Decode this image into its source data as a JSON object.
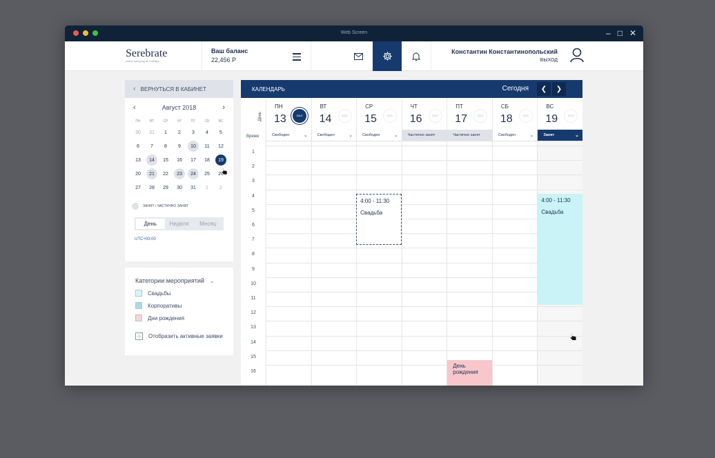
{
  "window": {
    "title": "Web Screen"
  },
  "header": {
    "logo_name": "Serebrate",
    "logo_tagline": "online shopping all holidays",
    "balance_label": "Ваш баланс",
    "balance_value": "22,456 Р",
    "user_name": "Константин Константинопольский",
    "logout_label": "ВЫХОД"
  },
  "sidebar": {
    "back_label": "ВЕРНУТЬСЯ В КАБИНЕТ",
    "mini_calendar": {
      "month_label": "Август 2018",
      "weekdays": [
        "ПН",
        "ВТ",
        "СР",
        "ЧТ",
        "ПТ",
        "СБ",
        "ВС"
      ],
      "days": [
        {
          "d": "30",
          "s": "muted"
        },
        {
          "d": "31",
          "s": "muted"
        },
        {
          "d": "1",
          "s": ""
        },
        {
          "d": "2",
          "s": ""
        },
        {
          "d": "3",
          "s": ""
        },
        {
          "d": "4",
          "s": ""
        },
        {
          "d": "5",
          "s": ""
        },
        {
          "d": "6",
          "s": ""
        },
        {
          "d": "7",
          "s": ""
        },
        {
          "d": "8",
          "s": ""
        },
        {
          "d": "9",
          "s": ""
        },
        {
          "d": "10",
          "s": "busy"
        },
        {
          "d": "11",
          "s": ""
        },
        {
          "d": "12",
          "s": ""
        },
        {
          "d": "13",
          "s": ""
        },
        {
          "d": "14",
          "s": "busy"
        },
        {
          "d": "15",
          "s": ""
        },
        {
          "d": "16",
          "s": ""
        },
        {
          "d": "17",
          "s": ""
        },
        {
          "d": "18",
          "s": ""
        },
        {
          "d": "19",
          "s": "sel"
        },
        {
          "d": "20",
          "s": ""
        },
        {
          "d": "21",
          "s": "busy"
        },
        {
          "d": "22",
          "s": ""
        },
        {
          "d": "23",
          "s": "busy"
        },
        {
          "d": "24",
          "s": "busy"
        },
        {
          "d": "25",
          "s": ""
        },
        {
          "d": "26",
          "s": ""
        },
        {
          "d": "27",
          "s": ""
        },
        {
          "d": "28",
          "s": ""
        },
        {
          "d": "29",
          "s": ""
        },
        {
          "d": "30",
          "s": ""
        },
        {
          "d": "31",
          "s": ""
        },
        {
          "d": "1",
          "s": "muted"
        },
        {
          "d": "2",
          "s": "muted"
        }
      ],
      "legend_busy": "ЗАНЯТ / ЧАСТИЧНО ЗАНЯТ"
    },
    "view_switch": [
      "День",
      "Неделя",
      "Месяц"
    ],
    "view_active": "День",
    "timezone": "UTC+03:00",
    "categories": {
      "title": "Категории мероприятий",
      "items": [
        {
          "label": "Свадьбы",
          "color": "#d6f6f8"
        },
        {
          "label": "Корпоративы",
          "color": "#a9dbea"
        },
        {
          "label": "Дни рождения",
          "color": "#f9d4d8"
        }
      ],
      "show_active_label": "Отобразить активные заявки"
    }
  },
  "calendar": {
    "bar_title": "КАЛЕНДАРЬ",
    "today_label": "Сегодня",
    "day_vertical_label": "День",
    "time_label": "Время",
    "sale_label": "SALE",
    "days": [
      {
        "dow": "ПН",
        "num": "13",
        "status": "Свободен",
        "status_type": "free",
        "sale_dark": true
      },
      {
        "dow": "ВТ",
        "num": "14",
        "status": "Свободен",
        "status_type": "free",
        "sale_dark": false
      },
      {
        "dow": "СР",
        "num": "15",
        "status": "Свободен",
        "status_type": "free",
        "sale_dark": false
      },
      {
        "dow": "ЧТ",
        "num": "16",
        "status": "Частично занят",
        "status_type": "partial",
        "sale_dark": false
      },
      {
        "dow": "ПТ",
        "num": "17",
        "status": "Частично занят",
        "status_type": "partial",
        "sale_dark": false
      },
      {
        "dow": "СБ",
        "num": "18",
        "status": "Свободен",
        "status_type": "free",
        "sale_dark": false
      },
      {
        "dow": "ВС",
        "num": "19",
        "status": "Занят",
        "status_type": "busy",
        "sale_dark": false
      }
    ],
    "hours": [
      "1",
      "2",
      "3",
      "4",
      "5",
      "6",
      "7",
      "8",
      "9",
      "10",
      "11",
      "12",
      "13",
      "14",
      "15",
      "16"
    ],
    "events": [
      {
        "day": 2,
        "time": "4:00 - 11:30",
        "title": "Свадьба",
        "style": "dashed",
        "start": 4,
        "end": 7.5
      },
      {
        "day": 6,
        "time": "4:00 - 11:30",
        "title": "Свадьба",
        "style": "wedding",
        "start": 4,
        "end": 11.6
      },
      {
        "day": 4,
        "time": "",
        "title": "День рождения",
        "style": "birthday",
        "start": 15,
        "end": 16.5
      }
    ]
  }
}
